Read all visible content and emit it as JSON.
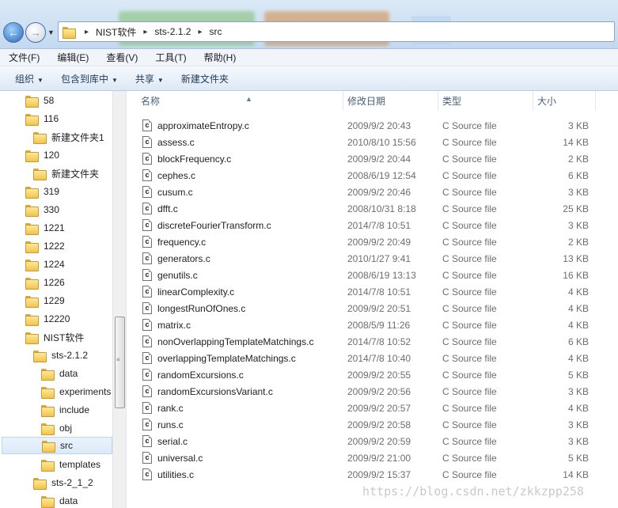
{
  "address": {
    "segments": [
      "NIST软件",
      "sts-2.1.2",
      "src"
    ]
  },
  "menu": [
    "文件(F)",
    "编辑(E)",
    "查看(V)",
    "工具(T)",
    "帮助(H)"
  ],
  "toolbar": {
    "organize": "组织",
    "include_in_library": "包含到库中",
    "share": "共享",
    "new_folder": "新建文件夹"
  },
  "nav": [
    {
      "label": "58"
    },
    {
      "label": "116"
    },
    {
      "label": "新建文件夹1"
    },
    {
      "label": "120"
    },
    {
      "label": "新建文件夹"
    },
    {
      "label": "319"
    },
    {
      "label": "330"
    },
    {
      "label": "1221"
    },
    {
      "label": "1222"
    },
    {
      "label": "1224"
    },
    {
      "label": "1226"
    },
    {
      "label": "1229"
    },
    {
      "label": "12220"
    },
    {
      "label": "NIST软件"
    },
    {
      "label": "sts-2.1.2"
    },
    {
      "label": "data"
    },
    {
      "label": "experiments"
    },
    {
      "label": "include"
    },
    {
      "label": "obj"
    },
    {
      "label": "src"
    },
    {
      "label": "templates"
    },
    {
      "label": "sts-2_1_2"
    },
    {
      "label": "data"
    }
  ],
  "columns": {
    "name": "名称",
    "date": "修改日期",
    "type": "类型",
    "size": "大小"
  },
  "files": [
    {
      "name": "approximateEntropy.c",
      "date": "2009/9/2 20:43",
      "type": "C Source file",
      "size": "3 KB"
    },
    {
      "name": "assess.c",
      "date": "2010/8/10 15:56",
      "type": "C Source file",
      "size": "14 KB"
    },
    {
      "name": "blockFrequency.c",
      "date": "2009/9/2 20:44",
      "type": "C Source file",
      "size": "2 KB"
    },
    {
      "name": "cephes.c",
      "date": "2008/6/19 12:54",
      "type": "C Source file",
      "size": "6 KB"
    },
    {
      "name": "cusum.c",
      "date": "2009/9/2 20:46",
      "type": "C Source file",
      "size": "3 KB"
    },
    {
      "name": "dfft.c",
      "date": "2008/10/31 8:18",
      "type": "C Source file",
      "size": "25 KB"
    },
    {
      "name": "discreteFourierTransform.c",
      "date": "2014/7/8 10:51",
      "type": "C Source file",
      "size": "3 KB"
    },
    {
      "name": "frequency.c",
      "date": "2009/9/2 20:49",
      "type": "C Source file",
      "size": "2 KB"
    },
    {
      "name": "generators.c",
      "date": "2010/1/27 9:41",
      "type": "C Source file",
      "size": "13 KB"
    },
    {
      "name": "genutils.c",
      "date": "2008/6/19 13:13",
      "type": "C Source file",
      "size": "16 KB"
    },
    {
      "name": "linearComplexity.c",
      "date": "2014/7/8 10:51",
      "type": "C Source file",
      "size": "4 KB"
    },
    {
      "name": "longestRunOfOnes.c",
      "date": "2009/9/2 20:51",
      "type": "C Source file",
      "size": "4 KB"
    },
    {
      "name": "matrix.c",
      "date": "2008/5/9 11:26",
      "type": "C Source file",
      "size": "4 KB"
    },
    {
      "name": "nonOverlappingTemplateMatchings.c",
      "date": "2014/7/8 10:52",
      "type": "C Source file",
      "size": "6 KB"
    },
    {
      "name": "overlappingTemplateMatchings.c",
      "date": "2014/7/8 10:40",
      "type": "C Source file",
      "size": "4 KB"
    },
    {
      "name": "randomExcursions.c",
      "date": "2009/9/2 20:55",
      "type": "C Source file",
      "size": "5 KB"
    },
    {
      "name": "randomExcursionsVariant.c",
      "date": "2009/9/2 20:56",
      "type": "C Source file",
      "size": "3 KB"
    },
    {
      "name": "rank.c",
      "date": "2009/9/2 20:57",
      "type": "C Source file",
      "size": "4 KB"
    },
    {
      "name": "runs.c",
      "date": "2009/9/2 20:58",
      "type": "C Source file",
      "size": "3 KB"
    },
    {
      "name": "serial.c",
      "date": "2009/9/2 20:59",
      "type": "C Source file",
      "size": "3 KB"
    },
    {
      "name": "universal.c",
      "date": "2009/9/2 21:00",
      "type": "C Source file",
      "size": "5 KB"
    },
    {
      "name": "utilities.c",
      "date": "2009/9/2 15:37",
      "type": "C Source file",
      "size": "14 KB"
    }
  ],
  "watermark": "https://blog.csdn.net/zkkzpp258"
}
